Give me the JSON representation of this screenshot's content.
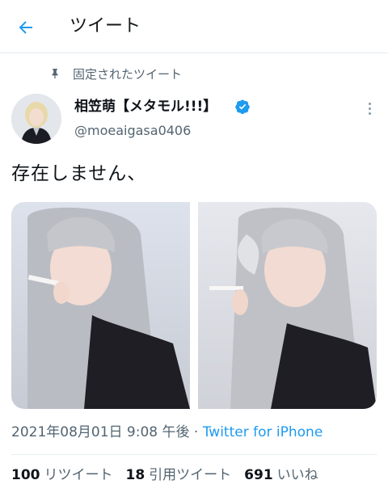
{
  "header": {
    "title": "ツイート",
    "back_icon": "back-arrow-icon",
    "accent_color": "#1d9bf0"
  },
  "pinned": {
    "label": "固定されたツイート",
    "icon": "pin-icon"
  },
  "author": {
    "display_name": "相笠萌【メタモル!!!】",
    "handle": "@moeaigasa0406",
    "verified": true
  },
  "tweet": {
    "text": "存在しません、",
    "media_count": 2
  },
  "meta": {
    "timestamp": "2021年08月01日 9:08 午後",
    "separator": " · ",
    "source": "Twitter for iPhone"
  },
  "stats": {
    "retweets_count": "100",
    "retweets_label": "リツイート",
    "quotes_count": "18",
    "quotes_label": "引用ツイート",
    "likes_count": "691",
    "likes_label": "いいね"
  }
}
